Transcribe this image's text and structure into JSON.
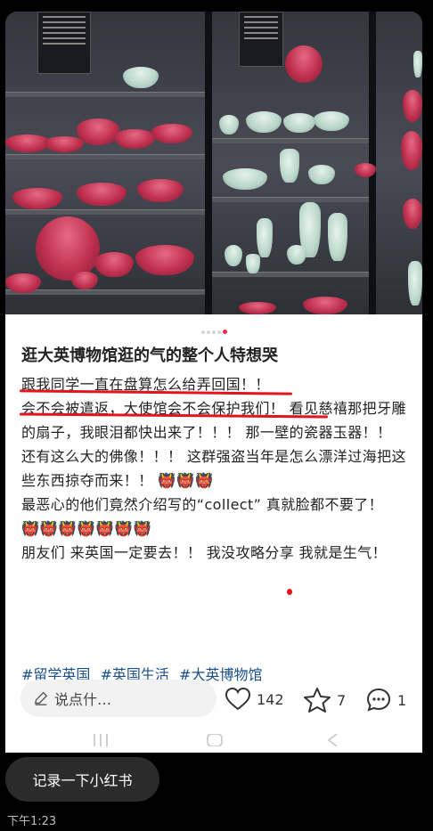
{
  "post": {
    "title": "逛大英博物馆逛的气的整个人特想哭",
    "paragraphs": [
      "跟我同学一直在盘算怎么给弄回国！！",
      "会不会被遣返，大使馆会不会保护我们！ 看见慈禧那把牙雕的扇子，我眼泪都快出来了！！！ 那一壁的瓷器玉器！！ 还有这么大的佛像！！！ 这群强盗当年是怎么漂洋过海把这些东西掠夺而来！！",
      "最恶心的他们竟然介绍写的“collect” 真就脸都不要了！",
      "朋友们 来英国一定要去！！  我没攻略分享 我就是生气！"
    ],
    "emoji_group_1": "👹👹👹",
    "emoji_group_2": "👹👹👹👹👹👹👹",
    "tags": [
      "#留学英国",
      "#英国生活",
      "#大英博物馆"
    ],
    "image_count": 5,
    "active_image_index": 4
  },
  "actions": {
    "comment_placeholder": "说点什…",
    "likes": "142",
    "favorites": "7",
    "comments": "1"
  },
  "toast": {
    "text": "记录一下小红书"
  },
  "status": {
    "time": "下午1:23"
  },
  "colors": {
    "accent": "#ff2442",
    "tag": "#1a4f8c",
    "underline": "#e3141b"
  }
}
